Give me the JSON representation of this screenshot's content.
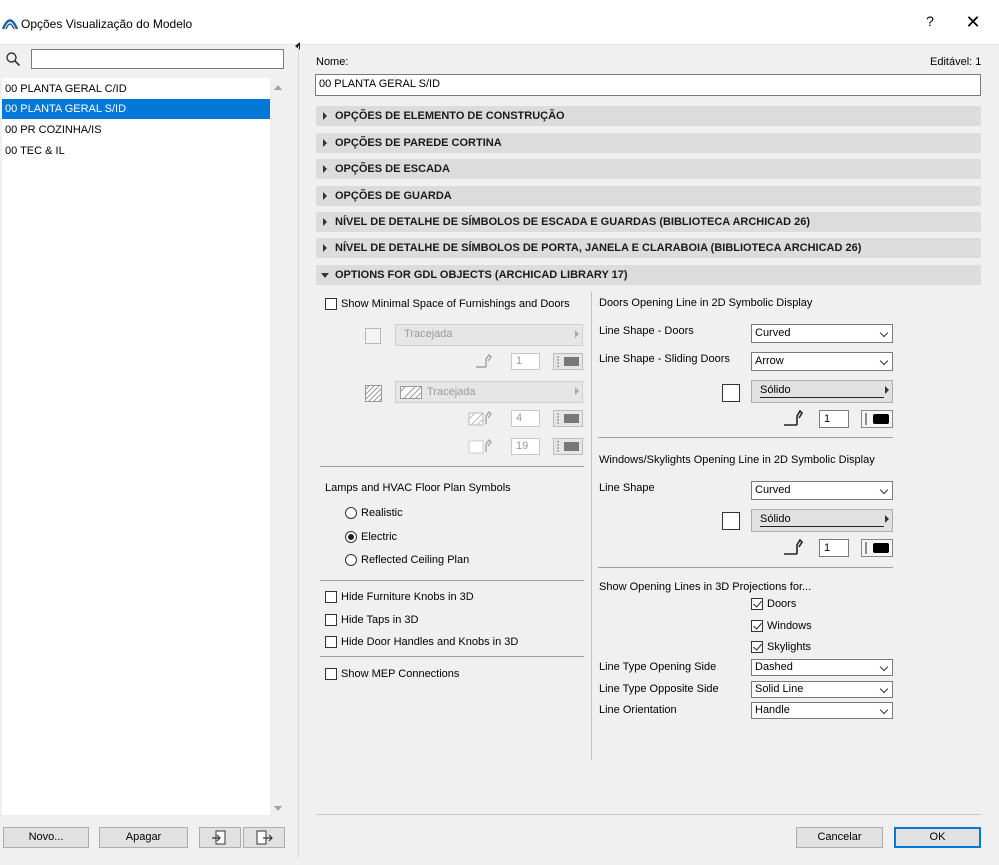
{
  "window": {
    "title": "Opções Visualização do Modelo",
    "help_glyph": "?",
    "close_glyph": "✕"
  },
  "left": {
    "search": {
      "value": "",
      "placeholder": ""
    },
    "items": [
      {
        "label": "00 PLANTA GERAL C/ID",
        "selected": false
      },
      {
        "label": "00 PLANTA GERAL S/ID",
        "selected": true
      },
      {
        "label": "00 PR COZINHA/IS",
        "selected": false
      },
      {
        "label": "00 TEC & IL",
        "selected": false
      }
    ],
    "buttons": {
      "new": "Novo...",
      "delete": "Apagar"
    }
  },
  "header": {
    "name_label": "Nome:",
    "editable": "Editável: 1",
    "name_value": "00 PLANTA GERAL S/ID"
  },
  "sections": [
    {
      "label": "OPÇÕES DE ELEMENTO DE CONSTRUÇÃO",
      "expanded": false
    },
    {
      "label": "OPÇÕES DE PAREDE CORTINA",
      "expanded": false
    },
    {
      "label": "OPÇÕES DE ESCADA",
      "expanded": false
    },
    {
      "label": "OPÇÕES DE GUARDA",
      "expanded": false
    },
    {
      "label": "NÍVEL DE DETALHE DE SÍMBOLOS DE ESCADA E GUARDAS (BIBLIOTECA ARCHICAD 26)",
      "expanded": false
    },
    {
      "label": "NÍVEL DE DETALHE DE SÍMBOLOS DE PORTA, JANELA E CLARABOIA (BIBLIOTECA ARCHICAD 26)",
      "expanded": false
    },
    {
      "label": "OPTIONS FOR GDL OBJECTS (ARCHICAD LIBRARY 17)",
      "expanded": true
    }
  ],
  "gdl": {
    "min_space": {
      "label": "Show Minimal Space of Furnishings and Doors",
      "checked": false
    },
    "line_type_1": "Tracejada",
    "pen_1": "1",
    "line_type_2": "Tracejada",
    "pen_2": "4",
    "pen_3": "19",
    "lamps_title": "Lamps and HVAC Floor Plan Symbols",
    "lamps_options": [
      {
        "label": "Realistic",
        "selected": false
      },
      {
        "label": "Electric",
        "selected": true
      },
      {
        "label": "Reflected Ceiling Plan",
        "selected": false
      }
    ],
    "hide_knobs": {
      "label": "Hide Furniture Knobs in 3D",
      "checked": false
    },
    "hide_taps": {
      "label": "Hide Taps in 3D",
      "checked": false
    },
    "hide_handles": {
      "label": "Hide Door Handles and Knobs in 3D",
      "checked": false
    },
    "show_mep": {
      "label": "Show MEP Connections",
      "checked": false
    },
    "doors_title": "Doors Opening Line in 2D Symbolic Display",
    "line_shape_doors_label": "Line Shape - Doors",
    "line_shape_doors_value": "Curved",
    "line_shape_sliding_label": "Line Shape - Sliding Doors",
    "line_shape_sliding_value": "Arrow",
    "doors_line_type": "Sólido",
    "doors_pen": "1",
    "windows_title": "Windows/Skylights Opening Line in 2D Symbolic Display",
    "line_shape_label": "Line Shape",
    "line_shape_value": "Curved",
    "windows_line_type": "Sólido",
    "windows_pen": "1",
    "show3d_title": "Show Opening Lines in 3D Projections for...",
    "show3d_doors": {
      "label": "Doors",
      "checked": true
    },
    "show3d_windows": {
      "label": "Windows",
      "checked": true
    },
    "show3d_skylights": {
      "label": "Skylights",
      "checked": true
    },
    "lt_opening_label": "Line Type Opening Side",
    "lt_opening_value": "Dashed",
    "lt_opposite_label": "Line Type Opposite Side",
    "lt_opposite_value": "Solid Line",
    "orientation_label": "Line Orientation",
    "orientation_value": "Handle"
  },
  "footer": {
    "cancel": "Cancelar",
    "ok": "OK"
  },
  "colors": {
    "accent": "#0078d7",
    "section_bg": "#dcdcdc",
    "window_bg": "#f0f0f0"
  }
}
